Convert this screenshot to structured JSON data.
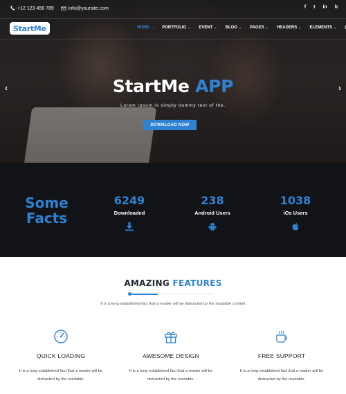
{
  "topbar": {
    "phone": "+12 123 456 789",
    "email": "info@yoursite.com",
    "social": [
      "f",
      "t",
      "in",
      "b"
    ]
  },
  "navbar": {
    "logo": "StartMe",
    "menu": [
      {
        "label": "HOME",
        "chevron": "⌄",
        "active": true
      },
      {
        "label": "PORTFOLIO",
        "chevron": "⌄"
      },
      {
        "label": "EVENT",
        "chevron": "⌄"
      },
      {
        "label": "BLOG",
        "chevron": "⌄"
      },
      {
        "label": "PAGES",
        "chevron": "⌄"
      },
      {
        "label": "HEADERS",
        "chevron": "⌄"
      },
      {
        "label": "ELEMENTS",
        "chevron": "⌄"
      }
    ]
  },
  "hero": {
    "title_main": "StartMe",
    "title_accent": "APP",
    "subtitle": "Lorem Ipsum is simply dummy text of the.",
    "button": "DOWNLOAD NOW",
    "arrow_left": "‹",
    "arrow_right": "›"
  },
  "facts": {
    "heading_line1": "Some",
    "heading_line2": "Facts",
    "items": [
      {
        "number": "6249",
        "label": "Downloaded",
        "icon": "download-icon"
      },
      {
        "number": "238",
        "label": "Android Users",
        "icon": "android-icon"
      },
      {
        "number": "1038",
        "label": "iOs Users",
        "icon": "apple-icon"
      }
    ]
  },
  "features": {
    "title_main": "AMAZING",
    "title_accent": "FEATURES",
    "subtitle": "It is a long established fact that a reader will be distracted by the readable content",
    "items": [
      {
        "title": "QUICK LOADING",
        "desc": "It is a long established fact that a reader will be distracted by the readable.",
        "icon": "speedometer-icon"
      },
      {
        "title": "AWESOME DESIGN",
        "desc": "It is a long established fact that a reader will be distracted by the readable.",
        "icon": "gift-icon"
      },
      {
        "title": "FREE SUPPORT",
        "desc": "It is a long established fact that a reader will be distracted by the readable.",
        "icon": "coffee-cup-icon"
      }
    ]
  },
  "colors": {
    "accent": "#2f82d3",
    "dark_section": "#121316",
    "heading_dark": "#1d2330"
  }
}
